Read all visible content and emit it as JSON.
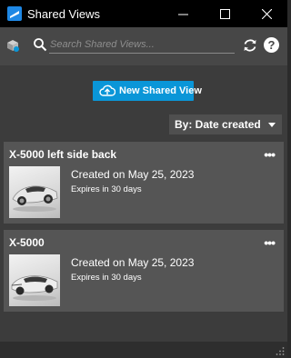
{
  "window": {
    "title": "Shared Views",
    "minimize_icon": "minimize-icon",
    "maximize_icon": "maximize-icon",
    "close_icon": "close-icon"
  },
  "toolbar": {
    "search_placeholder": "Search Shared Views...",
    "search_value": "",
    "help_glyph": "?"
  },
  "actions": {
    "new_shared_view_label": "New Shared View"
  },
  "sort": {
    "label": "By: Date created"
  },
  "shared_views": [
    {
      "title": "X-5000 left side back",
      "created": "Created on May 25, 2023",
      "expires": "Expires in 30 days",
      "more_label": "•••"
    },
    {
      "title": "X-5000",
      "created": "Created on May 25, 2023",
      "expires": "Expires in 30 days",
      "more_label": "•••"
    }
  ],
  "colors": {
    "accent": "#0a96d8",
    "titlebar": "#000000",
    "panel": "#3c3c3c",
    "card": "#555555"
  }
}
